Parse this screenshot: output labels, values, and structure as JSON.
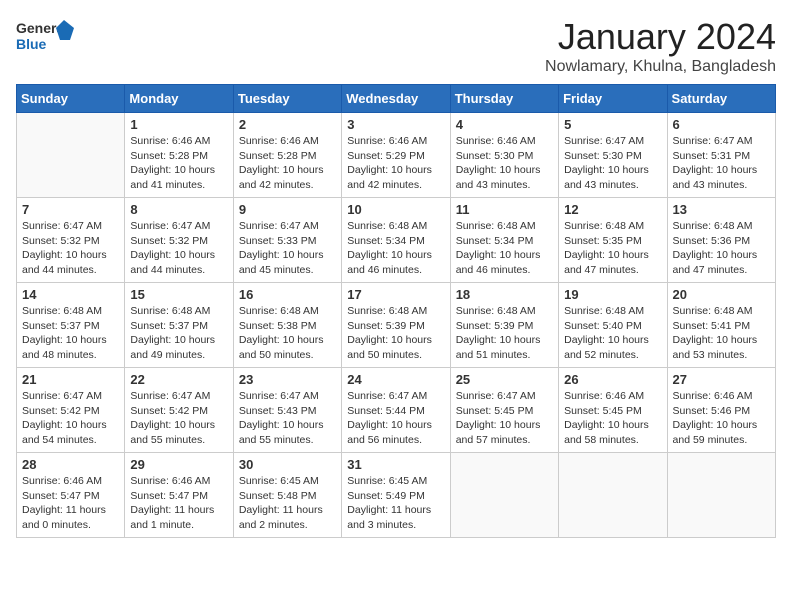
{
  "header": {
    "logo": {
      "line1": "General",
      "line2": "Blue"
    },
    "title": "January 2024",
    "subtitle": "Nowlamary, Khulna, Bangladesh"
  },
  "days_of_week": [
    "Sunday",
    "Monday",
    "Tuesday",
    "Wednesday",
    "Thursday",
    "Friday",
    "Saturday"
  ],
  "weeks": [
    [
      {
        "day": "",
        "info": ""
      },
      {
        "day": "1",
        "info": "Sunrise: 6:46 AM\nSunset: 5:28 PM\nDaylight: 10 hours\nand 41 minutes."
      },
      {
        "day": "2",
        "info": "Sunrise: 6:46 AM\nSunset: 5:28 PM\nDaylight: 10 hours\nand 42 minutes."
      },
      {
        "day": "3",
        "info": "Sunrise: 6:46 AM\nSunset: 5:29 PM\nDaylight: 10 hours\nand 42 minutes."
      },
      {
        "day": "4",
        "info": "Sunrise: 6:46 AM\nSunset: 5:30 PM\nDaylight: 10 hours\nand 43 minutes."
      },
      {
        "day": "5",
        "info": "Sunrise: 6:47 AM\nSunset: 5:30 PM\nDaylight: 10 hours\nand 43 minutes."
      },
      {
        "day": "6",
        "info": "Sunrise: 6:47 AM\nSunset: 5:31 PM\nDaylight: 10 hours\nand 43 minutes."
      }
    ],
    [
      {
        "day": "7",
        "info": "Sunrise: 6:47 AM\nSunset: 5:32 PM\nDaylight: 10 hours\nand 44 minutes."
      },
      {
        "day": "8",
        "info": "Sunrise: 6:47 AM\nSunset: 5:32 PM\nDaylight: 10 hours\nand 44 minutes."
      },
      {
        "day": "9",
        "info": "Sunrise: 6:47 AM\nSunset: 5:33 PM\nDaylight: 10 hours\nand 45 minutes."
      },
      {
        "day": "10",
        "info": "Sunrise: 6:48 AM\nSunset: 5:34 PM\nDaylight: 10 hours\nand 46 minutes."
      },
      {
        "day": "11",
        "info": "Sunrise: 6:48 AM\nSunset: 5:34 PM\nDaylight: 10 hours\nand 46 minutes."
      },
      {
        "day": "12",
        "info": "Sunrise: 6:48 AM\nSunset: 5:35 PM\nDaylight: 10 hours\nand 47 minutes."
      },
      {
        "day": "13",
        "info": "Sunrise: 6:48 AM\nSunset: 5:36 PM\nDaylight: 10 hours\nand 47 minutes."
      }
    ],
    [
      {
        "day": "14",
        "info": "Sunrise: 6:48 AM\nSunset: 5:37 PM\nDaylight: 10 hours\nand 48 minutes."
      },
      {
        "day": "15",
        "info": "Sunrise: 6:48 AM\nSunset: 5:37 PM\nDaylight: 10 hours\nand 49 minutes."
      },
      {
        "day": "16",
        "info": "Sunrise: 6:48 AM\nSunset: 5:38 PM\nDaylight: 10 hours\nand 50 minutes."
      },
      {
        "day": "17",
        "info": "Sunrise: 6:48 AM\nSunset: 5:39 PM\nDaylight: 10 hours\nand 50 minutes."
      },
      {
        "day": "18",
        "info": "Sunrise: 6:48 AM\nSunset: 5:39 PM\nDaylight: 10 hours\nand 51 minutes."
      },
      {
        "day": "19",
        "info": "Sunrise: 6:48 AM\nSunset: 5:40 PM\nDaylight: 10 hours\nand 52 minutes."
      },
      {
        "day": "20",
        "info": "Sunrise: 6:48 AM\nSunset: 5:41 PM\nDaylight: 10 hours\nand 53 minutes."
      }
    ],
    [
      {
        "day": "21",
        "info": "Sunrise: 6:47 AM\nSunset: 5:42 PM\nDaylight: 10 hours\nand 54 minutes."
      },
      {
        "day": "22",
        "info": "Sunrise: 6:47 AM\nSunset: 5:42 PM\nDaylight: 10 hours\nand 55 minutes."
      },
      {
        "day": "23",
        "info": "Sunrise: 6:47 AM\nSunset: 5:43 PM\nDaylight: 10 hours\nand 55 minutes."
      },
      {
        "day": "24",
        "info": "Sunrise: 6:47 AM\nSunset: 5:44 PM\nDaylight: 10 hours\nand 56 minutes."
      },
      {
        "day": "25",
        "info": "Sunrise: 6:47 AM\nSunset: 5:45 PM\nDaylight: 10 hours\nand 57 minutes."
      },
      {
        "day": "26",
        "info": "Sunrise: 6:46 AM\nSunset: 5:45 PM\nDaylight: 10 hours\nand 58 minutes."
      },
      {
        "day": "27",
        "info": "Sunrise: 6:46 AM\nSunset: 5:46 PM\nDaylight: 10 hours\nand 59 minutes."
      }
    ],
    [
      {
        "day": "28",
        "info": "Sunrise: 6:46 AM\nSunset: 5:47 PM\nDaylight: 11 hours\nand 0 minutes."
      },
      {
        "day": "29",
        "info": "Sunrise: 6:46 AM\nSunset: 5:47 PM\nDaylight: 11 hours\nand 1 minute."
      },
      {
        "day": "30",
        "info": "Sunrise: 6:45 AM\nSunset: 5:48 PM\nDaylight: 11 hours\nand 2 minutes."
      },
      {
        "day": "31",
        "info": "Sunrise: 6:45 AM\nSunset: 5:49 PM\nDaylight: 11 hours\nand 3 minutes."
      },
      {
        "day": "",
        "info": ""
      },
      {
        "day": "",
        "info": ""
      },
      {
        "day": "",
        "info": ""
      }
    ]
  ]
}
